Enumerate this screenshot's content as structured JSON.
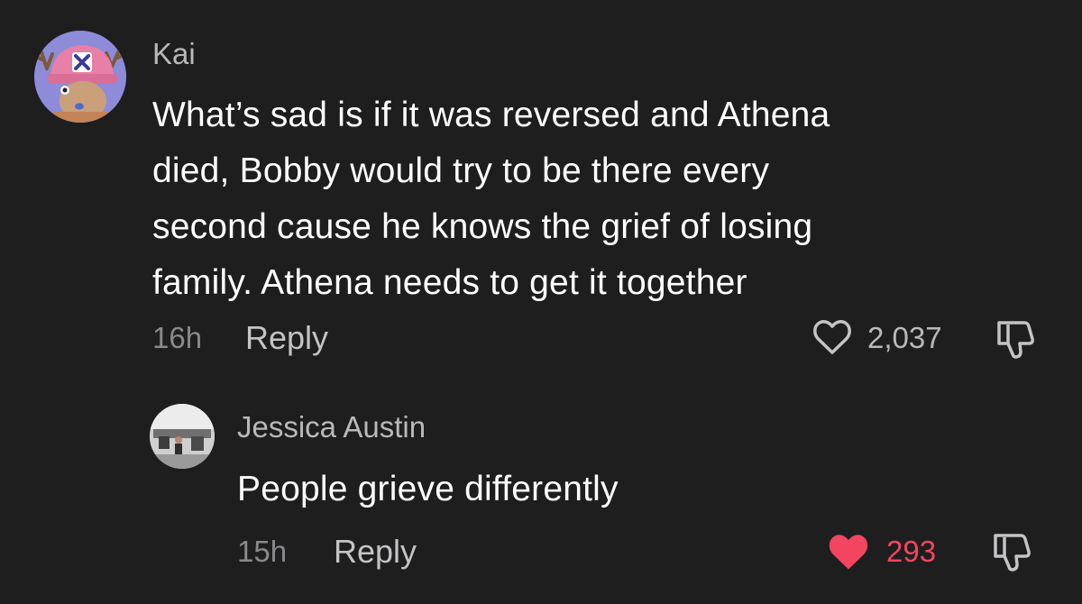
{
  "colors": {
    "background": "#1e1e1f",
    "liked_heart": "#f2455f",
    "muted_text": "#8a8a8c"
  },
  "comments": [
    {
      "username": "Kai",
      "text_lines": [
        "What’s sad is if it was reversed and Athena",
        "died, Bobby would try to be there every",
        "second cause he knows the grief of losing",
        "family. Athena needs to get it together"
      ],
      "time": "16h",
      "reply_label": "Reply",
      "like_count": "2,037",
      "liked": false,
      "avatar_icon": "chopper-avatar-icon"
    },
    {
      "username": "Jessica  Austin",
      "text_lines": [
        "People grieve differently"
      ],
      "time": "15h",
      "reply_label": "Reply",
      "like_count": "293",
      "liked": true,
      "avatar_icon": "photo-avatar-icon"
    }
  ]
}
